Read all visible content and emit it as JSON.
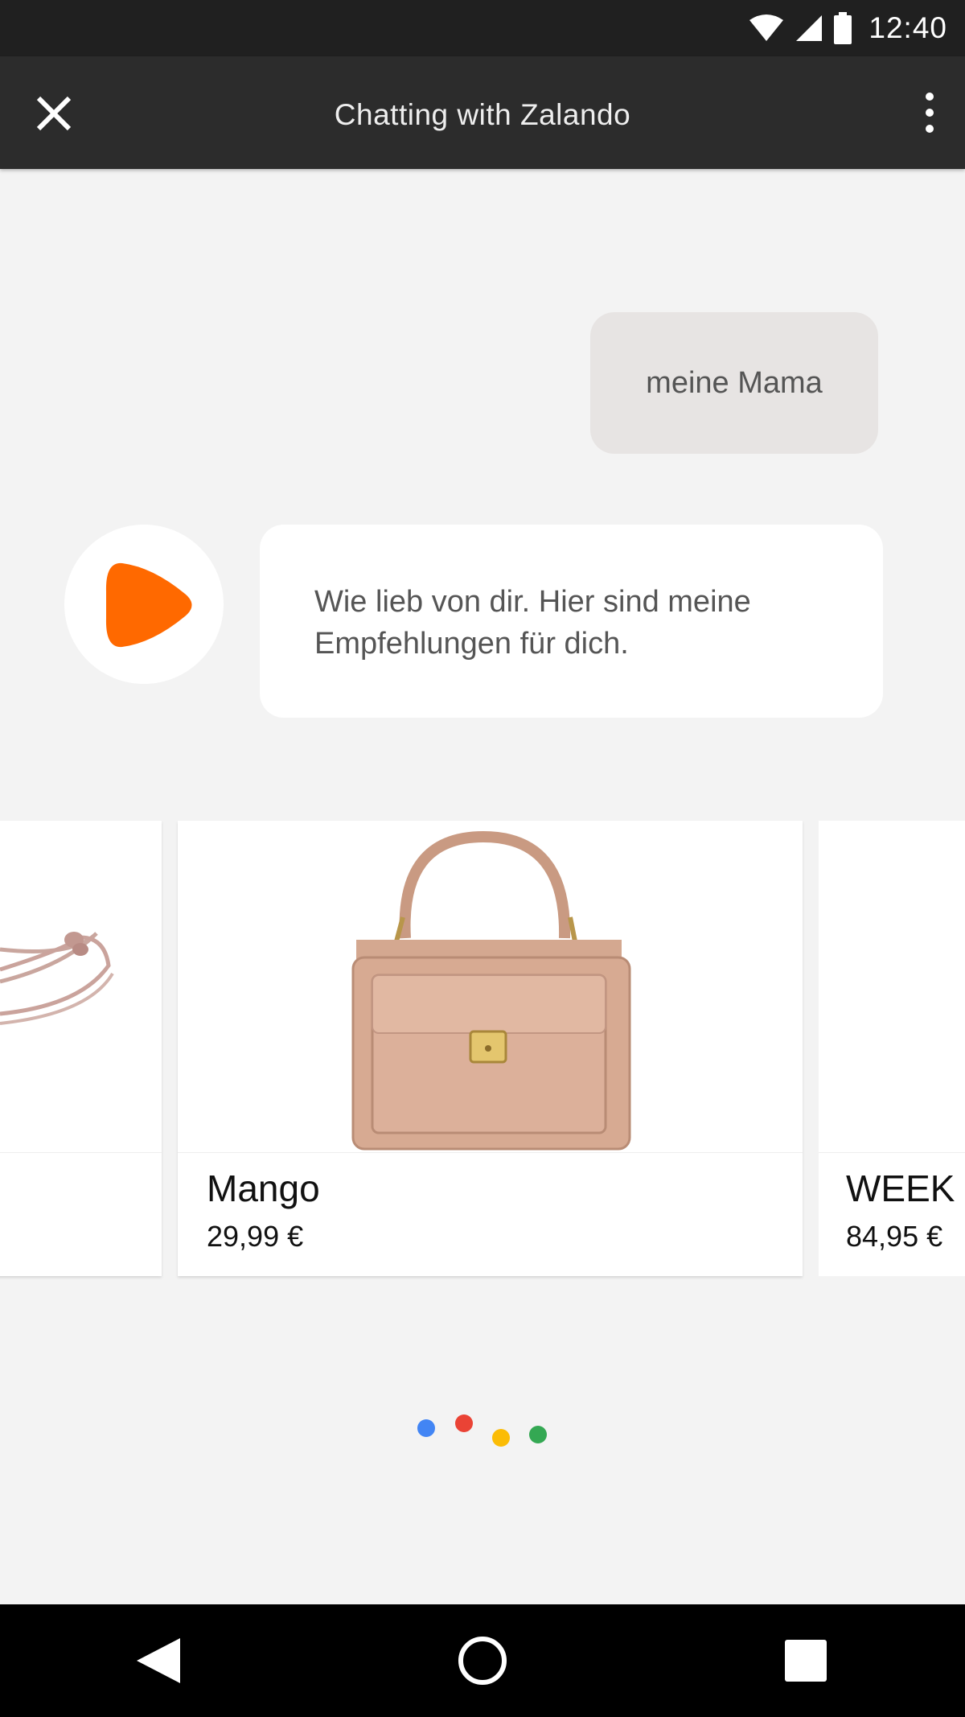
{
  "status_bar": {
    "time": "12:40"
  },
  "app_bar": {
    "title": "Chatting with Zalando"
  },
  "messages": {
    "user": "meine Mama",
    "bot": "Wie lieb von dir. Hier sind meine Empfehlungen für dich."
  },
  "products": [
    {
      "brand": "",
      "price": "",
      "image": "rose-gold-cord-bracelet"
    },
    {
      "brand": "Mango",
      "price": "29,99 €",
      "image": "nude-leather-handbag"
    },
    {
      "brand": "WEEK",
      "price": "84,95 €",
      "image": ""
    }
  ],
  "typing_indicator": {
    "colors": [
      "#4285F4",
      "#EA4335",
      "#FBBC05",
      "#34A853"
    ]
  },
  "colors": {
    "brand_orange": "#FF6900",
    "app_bar": "#2c2c2c"
  }
}
